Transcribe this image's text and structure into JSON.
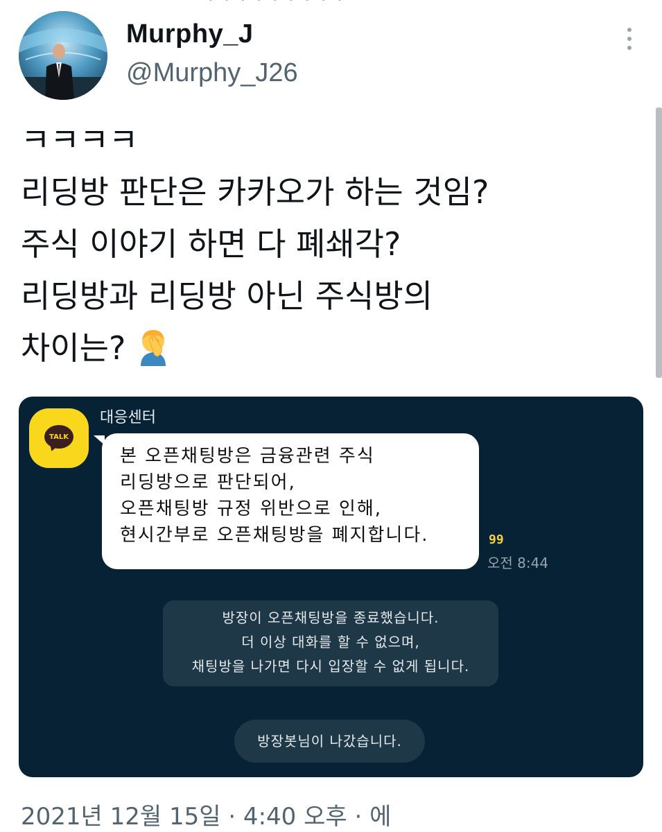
{
  "user": {
    "display_name": "Murphy_J",
    "handle": "@Murphy_J26"
  },
  "tweet": {
    "lines": [
      "ㅋㅋㅋㅋ",
      "리딩방 판단은 카카오가 하는 것임?",
      "주식 이야기 하면 다 폐쇄각?",
      "리딩방과 리딩방 아닌 주식방의",
      "차이는?"
    ],
    "emoji": "facepalm-emoji"
  },
  "chat": {
    "talk_badge": "TALK",
    "sender": "대응센터",
    "message_lines": [
      "본 오픈채팅방은 금융관련 주식",
      "리딩방으로 판단되어,",
      "오픈채팅방 규정 위반으로 인해,",
      "현시간부로 오픈채팅방을 폐지합니다."
    ],
    "unread_count": "99",
    "message_time": "오전 8:44",
    "system_notice_lines": [
      "방장이 오픈채팅방을 종료했습니다.",
      "더 이상 대화를 할 수 없으며,",
      "채팅방을 나가면 다시 입장할 수 없게 됩니다."
    ],
    "leave_notice": "방장봇님이 나갔습니다."
  },
  "footer": {
    "timestamp": "2021년 12월 15일 · 4:40 오후 · 에"
  },
  "colors": {
    "chat_background": "#072235",
    "kakao_yellow": "#f9d71c",
    "handle_gray": "#536471"
  }
}
